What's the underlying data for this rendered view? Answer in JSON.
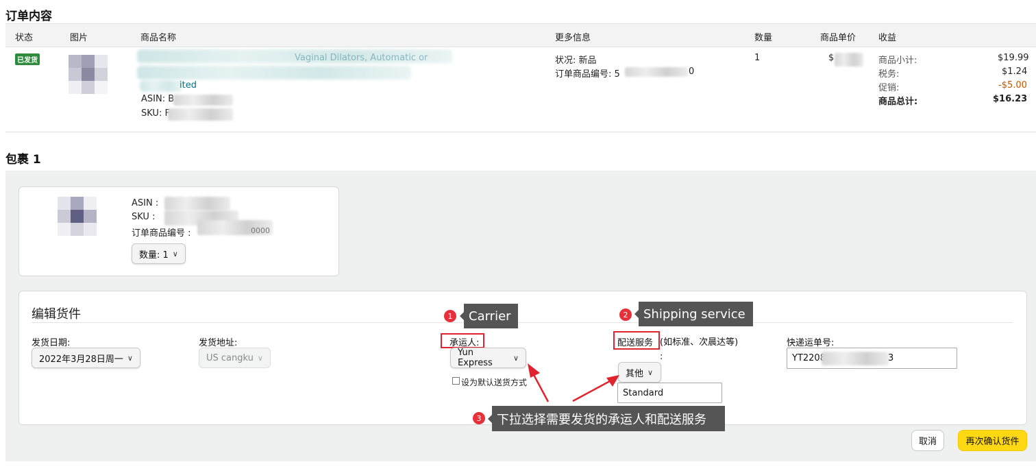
{
  "order": {
    "section_title": "订单内容",
    "columns": [
      "状态",
      "图片",
      "商品名称",
      "更多信息",
      "数量",
      "商品单价",
      "收益"
    ],
    "status_badge": "已发货",
    "product_title_partial": "Vaginal Dilators, Automatic or",
    "product_title_tail": "ited",
    "asin_label": "ASIN: B",
    "sku_label": "SKU: F",
    "condition": "状况: 新品",
    "order_item_id_label": "订单商品编号: 5",
    "order_item_id_tail": "0",
    "quantity": "1",
    "unit_price_prefix": "$",
    "proceeds": {
      "subtotal_label": "商品小计:",
      "subtotal": "$19.99",
      "tax_label": "税务:",
      "tax": "$1.24",
      "promo_label": "促销:",
      "promo": "-$5.00",
      "total_label": "商品总计:",
      "total": "$16.23"
    }
  },
  "package": {
    "title": "包裹 1",
    "asin_label": "ASIN :",
    "sku_label": "SKU :",
    "order_item_id_label": "订单商品编号 :",
    "order_item_id_tail": "0000",
    "quantity_select": "数量: 1",
    "edit_title": "编辑货件",
    "ship_date_label": "发货日期:",
    "ship_date_value": "2022年3月28日周一",
    "ship_from_label": "发货地址:",
    "ship_from_value": "US cangku",
    "carrier_label": "承运人:",
    "carrier_value": "Yun Express",
    "default_checkbox_label": "设为默认送货方式",
    "service_label": "配送服务",
    "service_hint": " (如标准、次晨达等) :",
    "service_value": "其他",
    "service_input": "Standard",
    "tracking_label": "快递运单号:",
    "tracking_value": "YT2208",
    "tracking_tail": "3",
    "cancel_button": "取消",
    "confirm_button": "再次确认货件"
  },
  "annotations": {
    "carrier": {
      "number": "1",
      "text": "Carrier"
    },
    "service": {
      "number": "2",
      "text": "Shipping service"
    },
    "hint": {
      "number": "3",
      "text": "下拉选择需要发货的承运人和配送服务"
    }
  },
  "colors": {
    "status_green": "#2e8b3e",
    "annotation_red": "#e0242f",
    "confirm_yellow": "#ffd814",
    "promo_orange": "#c45500",
    "link_teal": "#007185"
  }
}
